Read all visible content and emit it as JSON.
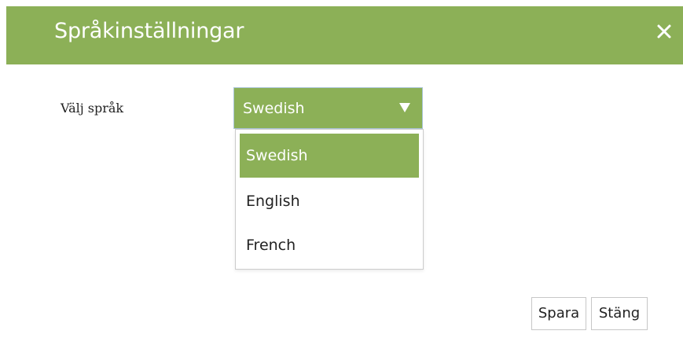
{
  "dialog": {
    "title": "Språkinställningar",
    "close_icon": "close-icon"
  },
  "language": {
    "label": "Välj språk",
    "selected": "Swedish",
    "options": [
      "Swedish",
      "English",
      "French"
    ]
  },
  "buttons": {
    "save_label": "Spara",
    "close_label": "Stäng"
  },
  "colors": {
    "accent": "#8cb057",
    "text": "#222222"
  }
}
